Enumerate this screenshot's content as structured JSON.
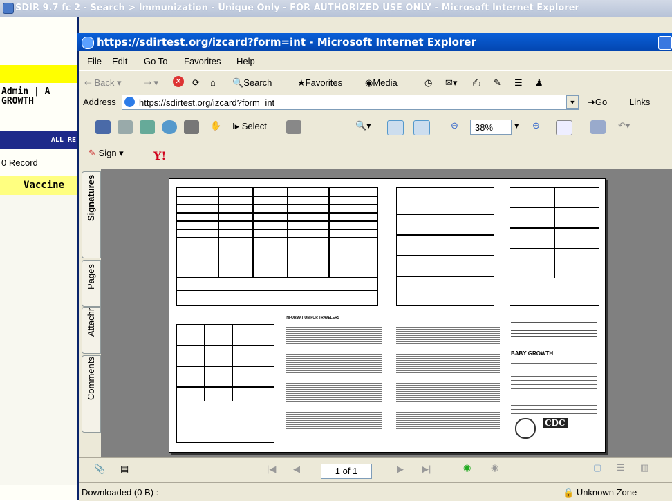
{
  "outer_window": {
    "title": "SDIR 9.7 fc 2 - Search > Immunization - Unique Only - FOR AUTHORIZED USE ONLY - Microsoft Internet Explorer"
  },
  "background_app": {
    "admin_line1": "Admin | A",
    "admin_line2": "GROWTH",
    "blue_bar": "ALL RE",
    "records": "0 Record",
    "vaccine_tab": "Vaccine"
  },
  "ie_window": {
    "title": "https://sdirtest.org/izcard?form=int - Microsoft Internet Explorer"
  },
  "menu": [
    "File",
    "Edit",
    "Go To",
    "Favorites",
    "Help"
  ],
  "toolbar": {
    "back": "Back",
    "search": "Search",
    "favorites": "Favorites",
    "media": "Media"
  },
  "address": {
    "label": "Address",
    "url": "https://sdirtest.org/izcard?form=int",
    "go": "Go",
    "links": "Links"
  },
  "pdf_toolbar": {
    "select": "Select",
    "zoom": "38%"
  },
  "sign_toolbar": {
    "sign": "Sign"
  },
  "side_tabs": [
    "Signatures",
    "Pages",
    "Attachments",
    "Comments"
  ],
  "document": {
    "baby_growth": "BABY GROWTH",
    "cdc": "CDC",
    "info_heading": "INFORMATION FOR TRAVELERS"
  },
  "nav": {
    "page": "1 of 1"
  },
  "status": {
    "text": "Downloaded (0 B) :",
    "zone": "Unknown Zone"
  },
  "colors": {
    "ie_title": "#0a5fd8",
    "viewer_bg": "#808080",
    "yellow": "#ffff00"
  }
}
